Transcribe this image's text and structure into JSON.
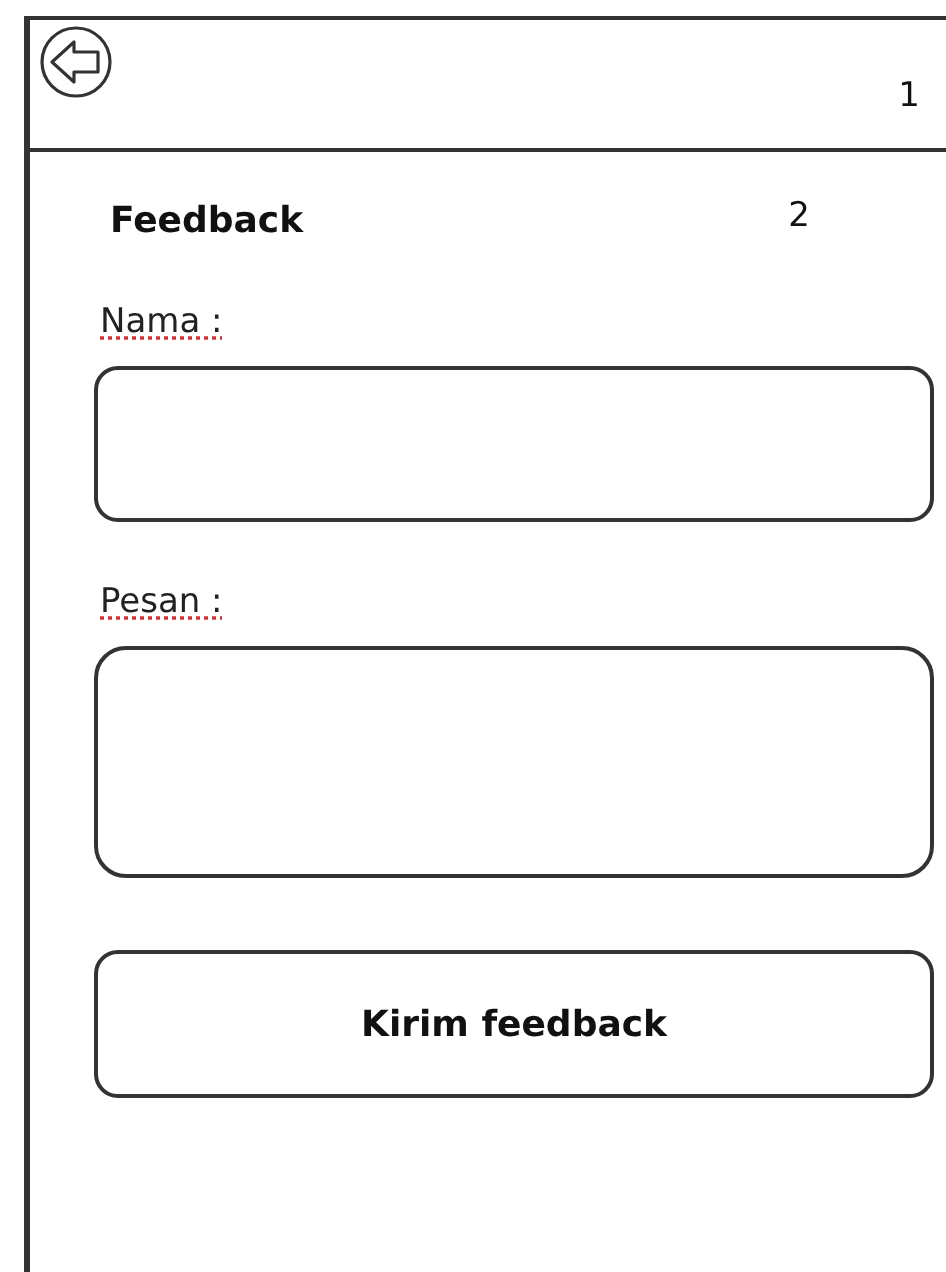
{
  "header": {
    "marker": "1"
  },
  "form": {
    "title": "Feedback",
    "marker": "2",
    "fields": [
      {
        "kind": "line",
        "label": "Nama :"
      },
      {
        "kind": "area",
        "label": "Pesan :"
      }
    ],
    "submit": {
      "label": "Kirim feedback"
    }
  }
}
